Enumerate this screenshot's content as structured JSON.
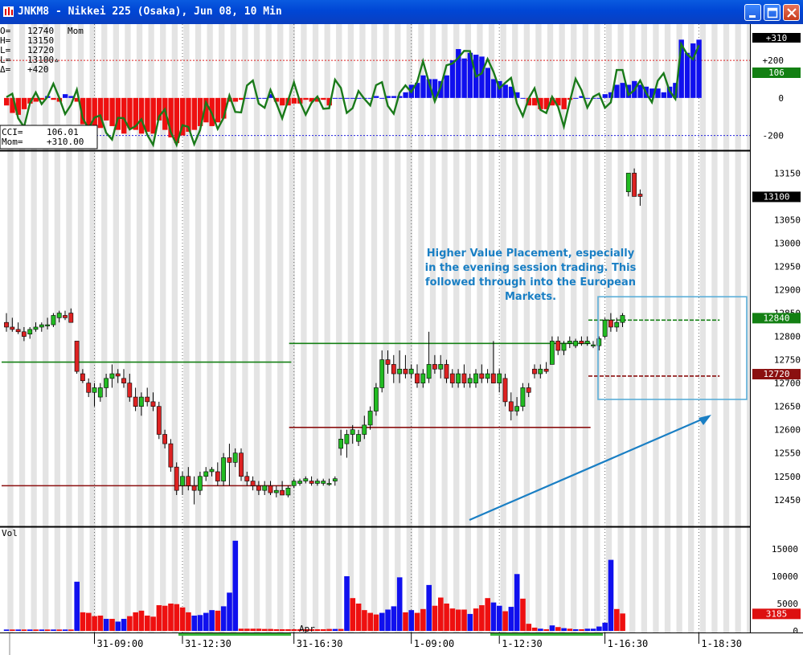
{
  "window": {
    "title": "JNKM8 - Nikkei 225 (Osaka), Jun 08, 10 Min",
    "buttons": [
      "minimize-icon",
      "maximize-icon",
      "close-icon"
    ]
  },
  "colors": {
    "stripe": "#e4e4e4",
    "up_volume": "#1010ee",
    "down_volume": "#ee1010",
    "cci_line": "#1a7a1a",
    "up_candle": "#22bb22",
    "down_candle": "#dd2222",
    "value_high": "#158015",
    "value_low": "#8b1010",
    "annotation": "#1a7fc4"
  },
  "chart_data": [
    {
      "type": "bar",
      "title": "Mom",
      "indicators": [
        "CCI",
        "Mom"
      ],
      "ohlc_header": [
        {
          "label": "O=",
          "value": "12740"
        },
        {
          "label": "H=",
          "value": "13150"
        },
        {
          "label": "L=",
          "value": "12720"
        },
        {
          "label": "L=",
          "value": "13100▵"
        },
        {
          "label": "Δ=",
          "value": "+420"
        }
      ],
      "readout": [
        {
          "label": "CCI=",
          "value": "106.01"
        },
        {
          "label": "Mom=",
          "value": "+310.00"
        }
      ],
      "y_ticks": [
        "+200",
        "0",
        "-200"
      ],
      "y_tick_values": [
        200,
        0,
        -200
      ],
      "reference_lines": [
        200,
        -200
      ],
      "ylim": [
        -270,
        350
      ],
      "last_labels": {
        "mom": "+310",
        "cci": "106"
      },
      "mom_values": [
        -40,
        -80,
        -90,
        -60,
        -30,
        -20,
        -10,
        10,
        -10,
        -20,
        20,
        10,
        -20,
        -140,
        -150,
        -170,
        -160,
        -120,
        -150,
        -170,
        -190,
        -160,
        -170,
        -190,
        -180,
        -190,
        -120,
        -170,
        -210,
        -240,
        -200,
        -180,
        -170,
        -150,
        -130,
        -150,
        -130,
        -110,
        -20,
        -20,
        -10,
        0,
        0,
        0,
        0,
        20,
        -20,
        -40,
        -40,
        -30,
        -30,
        -10,
        -20,
        -20,
        -10,
        -40,
        0,
        0,
        0,
        0,
        0,
        0,
        0,
        10,
        0,
        10,
        10,
        10,
        30,
        70,
        80,
        120,
        100,
        100,
        90,
        120,
        200,
        260,
        210,
        240,
        230,
        220,
        160,
        100,
        90,
        70,
        60,
        30,
        0,
        -40,
        -40,
        -60,
        -60,
        -40,
        -40,
        -60,
        -10,
        0,
        10,
        0,
        0,
        0,
        20,
        30,
        70,
        80,
        70,
        90,
        70,
        60,
        50,
        50,
        30,
        60,
        80,
        310,
        240,
        290,
        310
      ]
    },
    {
      "type": "bar",
      "title": "",
      "y_ticks": [
        "13150",
        "13100",
        "13050",
        "13000",
        "12950",
        "12900",
        "12850",
        "12800",
        "12750",
        "12700",
        "12650",
        "12600",
        "12550",
        "12500",
        "12450"
      ],
      "y_tick_values": [
        13150,
        13100,
        13050,
        13000,
        12950,
        12900,
        12850,
        12800,
        12750,
        12700,
        12650,
        12600,
        12550,
        12500,
        12450
      ],
      "ylim": [
        12410,
        13180
      ],
      "last_labels": {
        "close": "13100",
        "value_high": "12840",
        "value_low": "12720"
      },
      "value_areas": [
        {
          "from": 0,
          "to": 48,
          "high": 12745,
          "low": 12480
        },
        {
          "from": 49,
          "to": 99,
          "high": 12785,
          "low": 12605
        },
        {
          "from": 100,
          "to": 121,
          "high": 12835,
          "low": 12715
        }
      ],
      "ohlc": [
        {
          "o": 12830,
          "h": 12850,
          "l": 12810,
          "c": 12820
        },
        {
          "o": 12820,
          "h": 12840,
          "l": 12810,
          "c": 12815
        },
        {
          "o": 12815,
          "h": 12830,
          "l": 12805,
          "c": 12810
        },
        {
          "o": 12810,
          "h": 12820,
          "l": 12790,
          "c": 12800
        },
        {
          "o": 12805,
          "h": 12820,
          "l": 12795,
          "c": 12815
        },
        {
          "o": 12815,
          "h": 12830,
          "l": 12810,
          "c": 12820
        },
        {
          "o": 12820,
          "h": 12830,
          "l": 12810,
          "c": 12825
        },
        {
          "o": 12825,
          "h": 12840,
          "l": 12815,
          "c": 12825
        },
        {
          "o": 12825,
          "h": 12850,
          "l": 12820,
          "c": 12845
        },
        {
          "o": 12840,
          "h": 12855,
          "l": 12830,
          "c": 12850
        },
        {
          "o": 12845,
          "h": 12855,
          "l": 12835,
          "c": 12840
        },
        {
          "o": 12850,
          "h": 12860,
          "l": 12830,
          "c": 12830
        },
        {
          "o": 12790,
          "h": 12790,
          "l": 12720,
          "c": 12725
        },
        {
          "o": 12720,
          "h": 12730,
          "l": 12700,
          "c": 12705
        },
        {
          "o": 12700,
          "h": 12710,
          "l": 12670,
          "c": 12680
        },
        {
          "o": 12680,
          "h": 12700,
          "l": 12650,
          "c": 12690
        },
        {
          "o": 12670,
          "h": 12700,
          "l": 12660,
          "c": 12690
        },
        {
          "o": 12690,
          "h": 12720,
          "l": 12670,
          "c": 12710
        },
        {
          "o": 12710,
          "h": 12740,
          "l": 12690,
          "c": 12720
        },
        {
          "o": 12720,
          "h": 12730,
          "l": 12700,
          "c": 12715
        },
        {
          "o": 12710,
          "h": 12730,
          "l": 12690,
          "c": 12700
        },
        {
          "o": 12700,
          "h": 12720,
          "l": 12660,
          "c": 12670
        },
        {
          "o": 12670,
          "h": 12690,
          "l": 12640,
          "c": 12650
        },
        {
          "o": 12650,
          "h": 12680,
          "l": 12630,
          "c": 12670
        },
        {
          "o": 12670,
          "h": 12690,
          "l": 12650,
          "c": 12660
        },
        {
          "o": 12660,
          "h": 12680,
          "l": 12640,
          "c": 12650
        },
        {
          "o": 12650,
          "h": 12660,
          "l": 12580,
          "c": 12590
        },
        {
          "o": 12590,
          "h": 12600,
          "l": 12560,
          "c": 12570
        },
        {
          "o": 12570,
          "h": 12580,
          "l": 12510,
          "c": 12520
        },
        {
          "o": 12520,
          "h": 12530,
          "l": 12460,
          "c": 12470
        },
        {
          "o": 12480,
          "h": 12510,
          "l": 12460,
          "c": 12500
        },
        {
          "o": 12500,
          "h": 12520,
          "l": 12470,
          "c": 12480
        },
        {
          "o": 12480,
          "h": 12500,
          "l": 12440,
          "c": 12470
        },
        {
          "o": 12470,
          "h": 12510,
          "l": 12460,
          "c": 12500
        },
        {
          "o": 12500,
          "h": 12520,
          "l": 12490,
          "c": 12510
        },
        {
          "o": 12510,
          "h": 12520,
          "l": 12500,
          "c": 12515
        },
        {
          "o": 12510,
          "h": 12530,
          "l": 12480,
          "c": 12490
        },
        {
          "o": 12490,
          "h": 12550,
          "l": 12480,
          "c": 12540
        },
        {
          "o": 12540,
          "h": 12570,
          "l": 12480,
          "c": 12530
        },
        {
          "o": 12530,
          "h": 12560,
          "l": 12520,
          "c": 12550
        },
        {
          "o": 12550,
          "h": 12560,
          "l": 12490,
          "c": 12500
        },
        {
          "o": 12500,
          "h": 12510,
          "l": 12480,
          "c": 12490
        },
        {
          "o": 12490,
          "h": 12500,
          "l": 12470,
          "c": 12480
        },
        {
          "o": 12480,
          "h": 12490,
          "l": 12460,
          "c": 12470
        },
        {
          "o": 12470,
          "h": 12490,
          "l": 12460,
          "c": 12480
        },
        {
          "o": 12480,
          "h": 12490,
          "l": 12460,
          "c": 12465
        },
        {
          "o": 12465,
          "h": 12480,
          "l": 12455,
          "c": 12470
        },
        {
          "o": 12470,
          "h": 12490,
          "l": 12460,
          "c": 12460
        },
        {
          "o": 12460,
          "h": 12480,
          "l": 12455,
          "c": 12475
        },
        {
          "o": 12480,
          "h": 12495,
          "l": 12475,
          "c": 12490
        },
        {
          "o": 12485,
          "h": 12495,
          "l": 12480,
          "c": 12490
        },
        {
          "o": 12490,
          "h": 12500,
          "l": 12485,
          "c": 12495
        },
        {
          "o": 12490,
          "h": 12500,
          "l": 12480,
          "c": 12485
        },
        {
          "o": 12485,
          "h": 12495,
          "l": 12480,
          "c": 12490
        },
        {
          "o": 12485,
          "h": 12495,
          "l": 12480,
          "c": 12490
        },
        {
          "o": 12485,
          "h": 12495,
          "l": 12480,
          "c": 12485
        },
        {
          "o": 12490,
          "h": 12500,
          "l": 12480,
          "c": 12495
        },
        {
          "o": 12560,
          "h": 12600,
          "l": 12545,
          "c": 12580
        },
        {
          "o": 12570,
          "h": 12600,
          "l": 12540,
          "c": 12590
        },
        {
          "o": 12590,
          "h": 12610,
          "l": 12570,
          "c": 12600
        },
        {
          "o": 12575,
          "h": 12600,
          "l": 12565,
          "c": 12590
        },
        {
          "o": 12590,
          "h": 12630,
          "l": 12580,
          "c": 12610
        },
        {
          "o": 12610,
          "h": 12650,
          "l": 12600,
          "c": 12640
        },
        {
          "o": 12640,
          "h": 12700,
          "l": 12630,
          "c": 12690
        },
        {
          "o": 12690,
          "h": 12770,
          "l": 12680,
          "c": 12750
        },
        {
          "o": 12750,
          "h": 12770,
          "l": 12720,
          "c": 12740
        },
        {
          "o": 12740,
          "h": 12760,
          "l": 12700,
          "c": 12720
        },
        {
          "o": 12720,
          "h": 12770,
          "l": 12700,
          "c": 12730
        },
        {
          "o": 12730,
          "h": 12760,
          "l": 12710,
          "c": 12720
        },
        {
          "o": 12720,
          "h": 12740,
          "l": 12710,
          "c": 12730
        },
        {
          "o": 12720,
          "h": 12740,
          "l": 12690,
          "c": 12700
        },
        {
          "o": 12700,
          "h": 12730,
          "l": 12690,
          "c": 12720
        },
        {
          "o": 12710,
          "h": 12810,
          "l": 12700,
          "c": 12740
        },
        {
          "o": 12740,
          "h": 12760,
          "l": 12720,
          "c": 12730
        },
        {
          "o": 12730,
          "h": 12760,
          "l": 12710,
          "c": 12740
        },
        {
          "o": 12740,
          "h": 12750,
          "l": 12700,
          "c": 12710
        },
        {
          "o": 12720,
          "h": 12730,
          "l": 12690,
          "c": 12700
        },
        {
          "o": 12700,
          "h": 12730,
          "l": 12690,
          "c": 12720
        },
        {
          "o": 12720,
          "h": 12740,
          "l": 12690,
          "c": 12700
        },
        {
          "o": 12700,
          "h": 12720,
          "l": 12690,
          "c": 12710
        },
        {
          "o": 12700,
          "h": 12730,
          "l": 12690,
          "c": 12720
        },
        {
          "o": 12720,
          "h": 12740,
          "l": 12700,
          "c": 12710
        },
        {
          "o": 12710,
          "h": 12730,
          "l": 12700,
          "c": 12720
        },
        {
          "o": 12720,
          "h": 12790,
          "l": 12700,
          "c": 12700
        },
        {
          "o": 12700,
          "h": 12730,
          "l": 12680,
          "c": 12720
        },
        {
          "o": 12710,
          "h": 12720,
          "l": 12650,
          "c": 12660
        },
        {
          "o": 12660,
          "h": 12680,
          "l": 12620,
          "c": 12640
        },
        {
          "o": 12640,
          "h": 12670,
          "l": 12630,
          "c": 12650
        },
        {
          "o": 12650,
          "h": 12700,
          "l": 12640,
          "c": 12690
        },
        {
          "o": 12690,
          "h": 12700,
          "l": 12670,
          "c": 12680
        },
        {
          "o": 12730,
          "h": 12740,
          "l": 12710,
          "c": 12720
        },
        {
          "o": 12720,
          "h": 12740,
          "l": 12710,
          "c": 12730
        },
        {
          "o": 12730,
          "h": 12745,
          "l": 12720,
          "c": 12725
        },
        {
          "o": 12740,
          "h": 12800,
          "l": 12740,
          "c": 12790
        },
        {
          "o": 12790,
          "h": 12800,
          "l": 12760,
          "c": 12770
        },
        {
          "o": 12770,
          "h": 12790,
          "l": 12760,
          "c": 12785
        },
        {
          "o": 12785,
          "h": 12800,
          "l": 12775,
          "c": 12790
        },
        {
          "o": 12780,
          "h": 12795,
          "l": 12775,
          "c": 12790
        },
        {
          "o": 12790,
          "h": 12800,
          "l": 12780,
          "c": 12785
        },
        {
          "o": 12785,
          "h": 12800,
          "l": 12780,
          "c": 12790
        },
        {
          "o": 12780,
          "h": 12790,
          "l": 12775,
          "c": 12782
        },
        {
          "o": 12780,
          "h": 12800,
          "l": 12770,
          "c": 12795
        },
        {
          "o": 12800,
          "h": 12840,
          "l": 12795,
          "c": 12835
        },
        {
          "o": 12835,
          "h": 12850,
          "l": 12810,
          "c": 12820
        },
        {
          "o": 12820,
          "h": 12840,
          "l": 12810,
          "c": 12830
        },
        {
          "o": 12830,
          "h": 12850,
          "l": 12820,
          "c": 12845
        },
        {
          "o": 13110,
          "h": 13150,
          "l": 13100,
          "c": 13150
        },
        {
          "o": 13150,
          "h": 13160,
          "l": 13100,
          "c": 13100
        },
        {
          "o": 13105,
          "h": 13115,
          "l": 13080,
          "c": 13100
        }
      ],
      "annotation": "Higher Value Placement, especially in the evening session trading. This followed through into the European Markets."
    },
    {
      "type": "bar",
      "title": "Vol",
      "y_ticks": [
        "15000",
        "10000",
        "5000",
        "0"
      ],
      "y_tick_values": [
        15000,
        10000,
        5000,
        0
      ],
      "ylim": [
        0,
        17500
      ],
      "last_label": "3185",
      "volume": [
        250,
        250,
        250,
        250,
        250,
        250,
        250,
        250,
        250,
        250,
        250,
        250,
        9000,
        3400,
        3300,
        2700,
        2800,
        2200,
        2200,
        1700,
        2200,
        2700,
        3400,
        3700,
        2800,
        2600,
        4700,
        4600,
        5000,
        4900,
        4300,
        3400,
        2800,
        2900,
        3300,
        3800,
        3700,
        4500,
        7000,
        16500,
        400,
        400,
        400,
        400,
        350,
        350,
        300,
        300,
        300,
        300,
        300,
        300,
        300,
        300,
        300,
        350,
        350,
        350,
        10000,
        6000,
        5000,
        3800,
        3300,
        3000,
        3300,
        3900,
        4500,
        9800,
        3400,
        3800,
        3300,
        4000,
        8400,
        4600,
        6100,
        5000,
        4100,
        3900,
        3900,
        3100,
        4100,
        4700,
        6000,
        5200,
        4600,
        3600,
        4400,
        10400,
        5900,
        1300,
        600,
        400,
        300,
        1000,
        700,
        500,
        400,
        300,
        300,
        400,
        400,
        800,
        1500,
        13000,
        4000,
        3185
      ],
      "volume_up": [
        true,
        false,
        true,
        false,
        true,
        false,
        true,
        false,
        true,
        false,
        true,
        false,
        true,
        false,
        false,
        false,
        false,
        true,
        false,
        true,
        true,
        false,
        false,
        false,
        false,
        false,
        false,
        false,
        false,
        false,
        false,
        false,
        true,
        true,
        true,
        true,
        false,
        true,
        true,
        true,
        false,
        false,
        false,
        false,
        false,
        false,
        false,
        false,
        false,
        false,
        false,
        false,
        false,
        false,
        false,
        false,
        true,
        false,
        true,
        false,
        false,
        false,
        false,
        false,
        true,
        true,
        true,
        true,
        false,
        true,
        false,
        false,
        true,
        false,
        false,
        false,
        false,
        false,
        false,
        true,
        false,
        false,
        false,
        true,
        true,
        false,
        true,
        true,
        false,
        false,
        false,
        true,
        false,
        true,
        false,
        true,
        false,
        true,
        false,
        true,
        true,
        true,
        true,
        true,
        false,
        false
      ]
    }
  ],
  "x_axis": {
    "labels": [
      "31-09:00",
      "31-12:30",
      "31-16:30",
      "1-09:00",
      "1-12:30",
      "1-16:30",
      "1-18:30"
    ],
    "month_marker": "Apr"
  }
}
